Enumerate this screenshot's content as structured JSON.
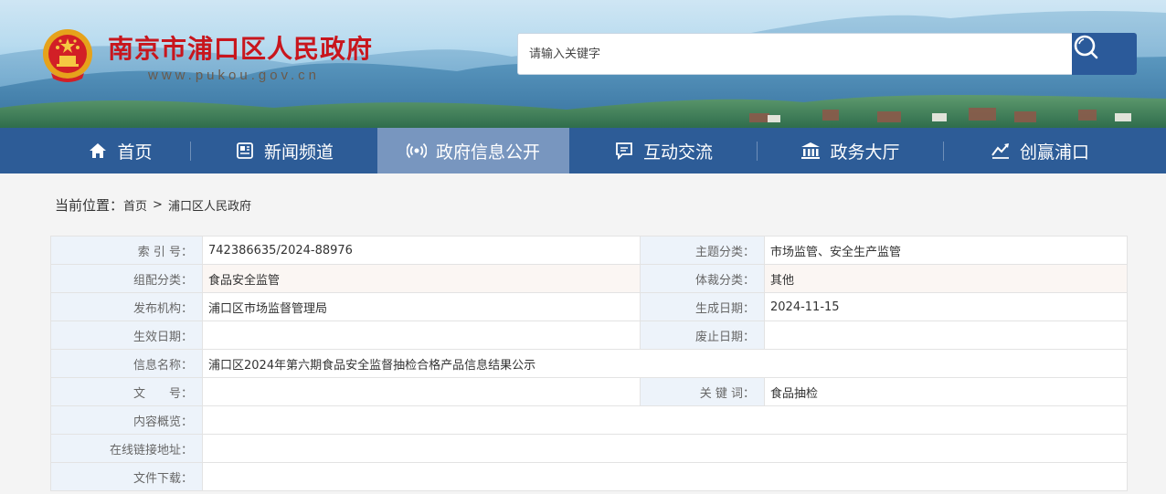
{
  "header": {
    "site_title": "南京市浦口区人民政府",
    "site_url": "www.pukou.gov.cn",
    "search": {
      "placeholder": "请输入关键字",
      "button_icon": "search-icon"
    }
  },
  "nav": {
    "items": [
      {
        "label": "首页",
        "icon": "home-icon",
        "active": false
      },
      {
        "label": "新闻频道",
        "icon": "news-icon",
        "active": false
      },
      {
        "label": "政府信息公开",
        "icon": "broadcast-icon",
        "active": true
      },
      {
        "label": "互动交流",
        "icon": "chat-icon",
        "active": false
      },
      {
        "label": "政务大厅",
        "icon": "building-icon",
        "active": false
      },
      {
        "label": "创赢浦口",
        "icon": "chart-icon",
        "active": false
      }
    ]
  },
  "breadcrumb": {
    "label": "当前位置：",
    "items": [
      "首页",
      "浦口区人民政府"
    ],
    "separator": ">"
  },
  "info": {
    "index_no": {
      "label": "索 引 号：",
      "value": "742386635/2024-88976"
    },
    "topic": {
      "label": "主题分类：",
      "value": "市场监管、安全生产监管"
    },
    "group": {
      "label": "组配分类：",
      "value": "食品安全监管"
    },
    "genre": {
      "label": "体裁分类：",
      "value": "其他"
    },
    "publisher": {
      "label": "发布机构：",
      "value": "浦口区市场监督管理局"
    },
    "created": {
      "label": "生成日期：",
      "value": "2024-11-15"
    },
    "effective": {
      "label": "生效日期：",
      "value": ""
    },
    "expired": {
      "label": "废止日期：",
      "value": ""
    },
    "name": {
      "label": "信息名称：",
      "value": "浦口区2024年第六期食品安全监督抽检合格产品信息结果公示"
    },
    "doc_no": {
      "label": "文　　号：",
      "value": ""
    },
    "keywords": {
      "label": "关 键 词：",
      "value": "食品抽检"
    },
    "summary": {
      "label": "内容概览：",
      "value": ""
    },
    "link": {
      "label": "在线链接地址：",
      "value": ""
    },
    "download": {
      "label": "文件下载：",
      "value": ""
    }
  },
  "colors": {
    "title_red": "#c8161d",
    "nav_blue": "#2d5c97",
    "nav_active": "#7896bf",
    "label_bg": "#edf3fa"
  }
}
